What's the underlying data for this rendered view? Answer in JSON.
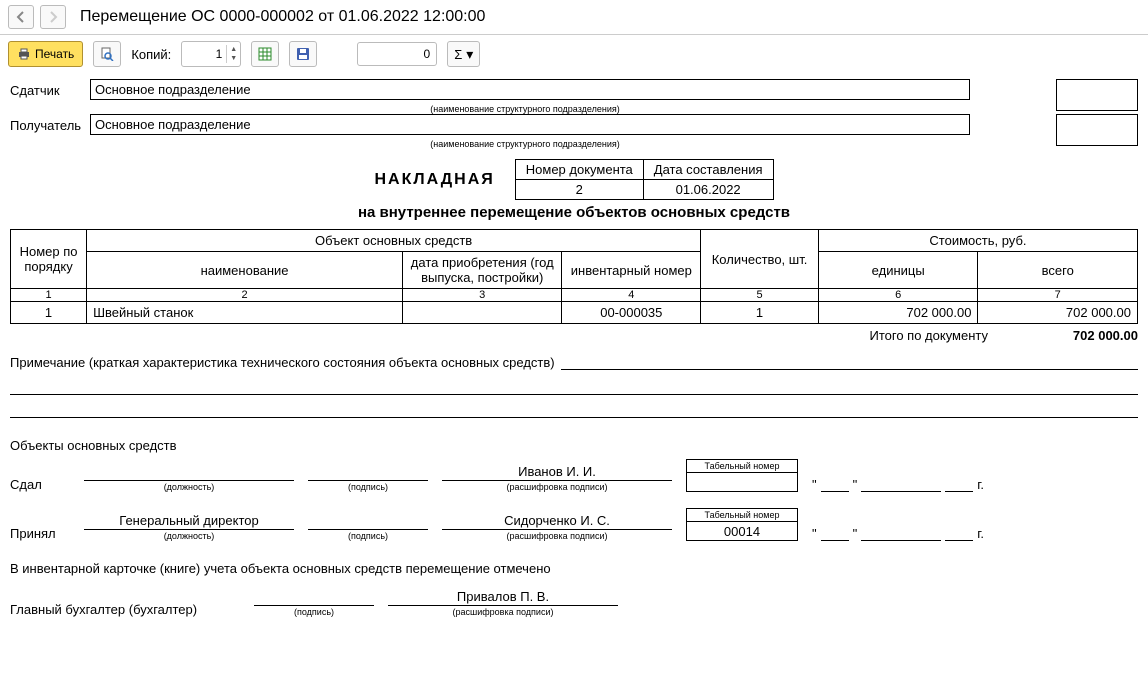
{
  "window": {
    "title": "Перемещение ОС 0000-000002 от 01.06.2022 12:00:00"
  },
  "toolbar": {
    "print_label": "Печать",
    "copies_label": "Копий:",
    "copies_value": "1",
    "pages_value": "0",
    "sigma": "Σ"
  },
  "parties": {
    "sender_label": "Сдатчик",
    "sender_value": "Основное подразделение",
    "receiver_label": "Получатель",
    "receiver_value": "Основное подразделение",
    "caption": "(наименование структурного подразделения)"
  },
  "header": {
    "title": "НАКЛАДНАЯ",
    "doc_num_label": "Номер документа",
    "doc_num": "2",
    "date_label": "Дата составления",
    "date": "01.06.2022",
    "subtitle": "на внутреннее перемещение объектов основных средств"
  },
  "table": {
    "headers": {
      "num": "Номер по порядку",
      "object": "Объект основных средств",
      "name": "наименование",
      "acq_date": "дата приобретения (год выпуска, постройки)",
      "inv_num": "инвентарный номер",
      "qty": "Количество, шт.",
      "cost": "Стоимость, руб.",
      "unit": "единицы",
      "total": "всего"
    },
    "cols": [
      "1",
      "2",
      "3",
      "4",
      "5",
      "6",
      "7"
    ],
    "rows": [
      {
        "num": "1",
        "name": "Швейный станок",
        "acq": "",
        "inv": "00-000035",
        "qty": "1",
        "unit": "702 000.00",
        "total": "702 000.00"
      }
    ]
  },
  "totals": {
    "label": "Итого по документу",
    "value": "702 000.00"
  },
  "note": {
    "label": "Примечание (краткая характеристика технического состояния объекта основных средств)"
  },
  "objects_label": "Объекты основных средств",
  "sig": {
    "gave_label": "Сдал",
    "gave_position": "",
    "gave_name": "Иванов И. И.",
    "took_label": "Принял",
    "took_position": "Генеральный директор",
    "took_name": "Сидорченко И. С.",
    "took_tabnum": "00014",
    "tabnum_label": "Табельный номер",
    "position_cap": "(должность)",
    "sign_cap": "(подпись)",
    "decode_cap": "(расшифровка подписи)",
    "year_suffix": "г."
  },
  "footer": {
    "card_note": "В инвентарной карточке (книге) учета объекта основных средств перемещение отмечено",
    "chief_label": "Главный бухгалтер (бухгалтер)",
    "chief_name": "Привалов П. В."
  }
}
